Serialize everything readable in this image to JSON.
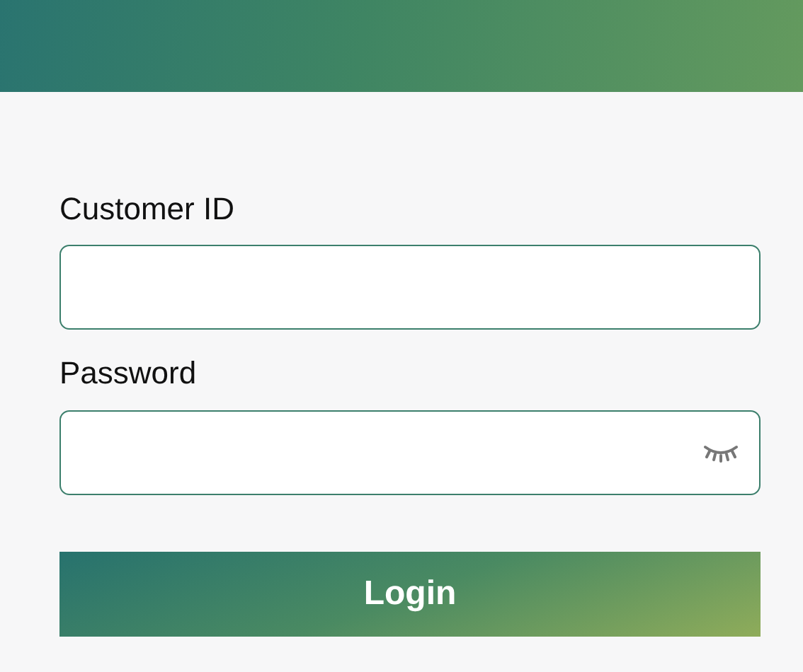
{
  "form": {
    "fields": [
      {
        "label": "Customer ID",
        "kind": "text"
      },
      {
        "label": "Password",
        "kind": "password"
      }
    ],
    "submit": "Login"
  }
}
